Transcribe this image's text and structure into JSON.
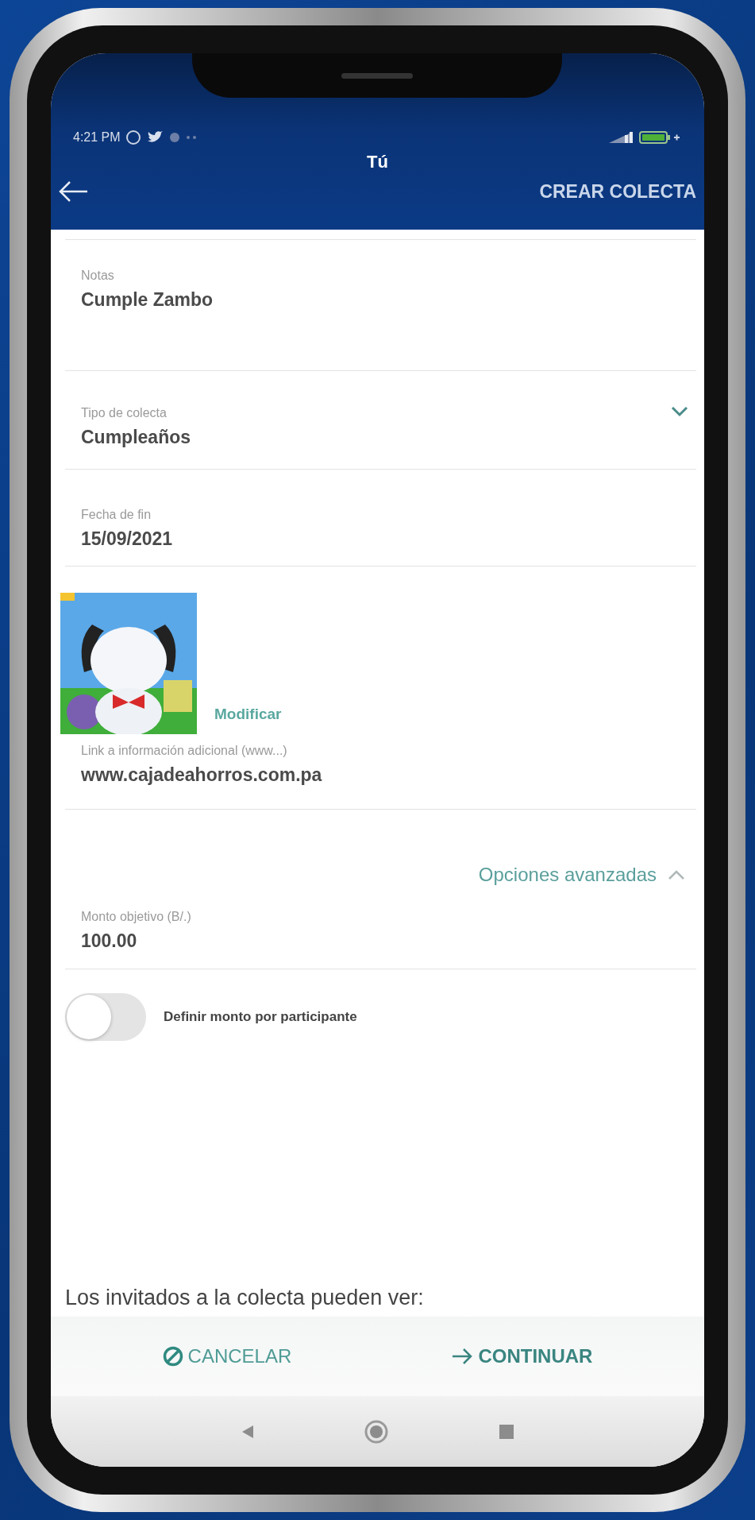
{
  "status_bar": {
    "time": "4:21 PM"
  },
  "header": {
    "title": "Tú",
    "action": "CREAR COLECTA"
  },
  "fields": [
    {
      "kind": "textarea",
      "label": "Notas",
      "value": "Cumple Zambo"
    },
    {
      "kind": "select",
      "label": "Tipo de colecta",
      "value": "Cumpleaños"
    },
    {
      "kind": "text",
      "label": "Fecha de fin",
      "value": "15/09/2021"
    }
  ],
  "image": {
    "kind": "picture",
    "action": "Modificar"
  },
  "link_field": {
    "label": "Link a información adicional (www...)",
    "value": "www.cajadeahorros.com.pa"
  },
  "advanced": {
    "label": "Opciones avanzadas",
    "expanded": true
  },
  "amount_field": {
    "label": "Monto objetivo (B/.)",
    "value": "100.00"
  },
  "toggle": {
    "label": "Definir monto por participante",
    "on": false
  },
  "footer_text": "Los invitados a la colecta pueden ver:",
  "buttons": [
    {
      "kind": "cancel",
      "label": "CANCELAR"
    },
    {
      "kind": "continue",
      "label": "CONTINUAR"
    }
  ]
}
